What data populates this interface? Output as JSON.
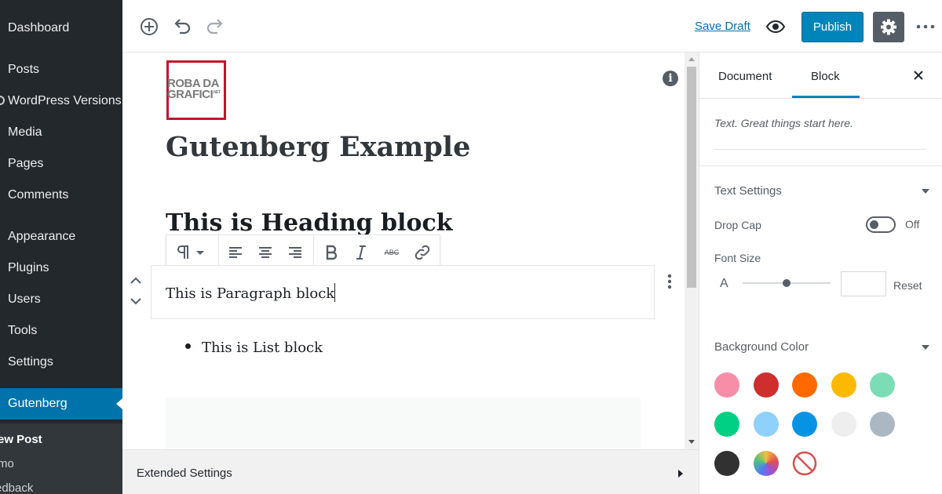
{
  "sidebar": {
    "items": [
      {
        "label": "Dashboard"
      },
      {
        "label": "Posts"
      },
      {
        "label": "WordPress Versions"
      },
      {
        "label": "Media"
      },
      {
        "label": "Pages"
      },
      {
        "label": "Comments"
      },
      {
        "label": "Appearance"
      },
      {
        "label": "Plugins"
      },
      {
        "label": "Users"
      },
      {
        "label": "Tools"
      },
      {
        "label": "Settings"
      },
      {
        "label": "Gutenberg"
      }
    ],
    "active_item": "Gutenberg",
    "submenu": [
      {
        "label": "ew Post"
      },
      {
        "label": "mo"
      },
      {
        "label": "edback"
      }
    ]
  },
  "toolbar": {
    "save_draft_label": "Save Draft",
    "publish_label": "Publish",
    "icons": [
      "add-block-icon",
      "undo-icon",
      "redo-icon",
      "preview-eye-icon",
      "settings-gear-icon",
      "more-vertical-icon"
    ]
  },
  "editor": {
    "logo": {
      "line1": "ROBA DA",
      "line2": "GRAFICI",
      "suffix": ".NET"
    },
    "post_title": "Gutenberg Example",
    "heading_block": "This is Heading block",
    "paragraph_block": "This is Paragraph block",
    "list_items": [
      "This is List block"
    ],
    "block_toolbar_icons": [
      "paragraph-icon",
      "chevron-down-icon",
      "align-left-icon",
      "align-center-icon",
      "align-right-icon",
      "bold-icon",
      "italic-icon",
      "strikethrough-icon",
      "link-icon"
    ],
    "strikethrough_label": "ABC"
  },
  "extended_settings": {
    "label": "Extended Settings"
  },
  "panel": {
    "tabs": [
      {
        "label": "Document"
      },
      {
        "label": "Block"
      }
    ],
    "active_tab": "Block",
    "block_description": "Text. Great things start here.",
    "text_settings": {
      "title": "Text Settings",
      "drop_cap_label": "Drop Cap",
      "drop_cap_state": "Off",
      "font_size_label": "Font Size",
      "font_size_glyph": "A",
      "font_size_value": "",
      "font_size_slider_fraction": 0.5,
      "reset_label": "Reset"
    },
    "background_color": {
      "title": "Background Color",
      "swatches": [
        "#f78da7",
        "#cf2e2e",
        "#ff6900",
        "#fcb900",
        "#7bdcb5",
        "#00d084",
        "#8ed1fc",
        "#0693e3",
        "#eeeeee",
        "#abb8c3",
        "#313131",
        "gradient"
      ],
      "clear_option": "no-color-icon"
    }
  }
}
